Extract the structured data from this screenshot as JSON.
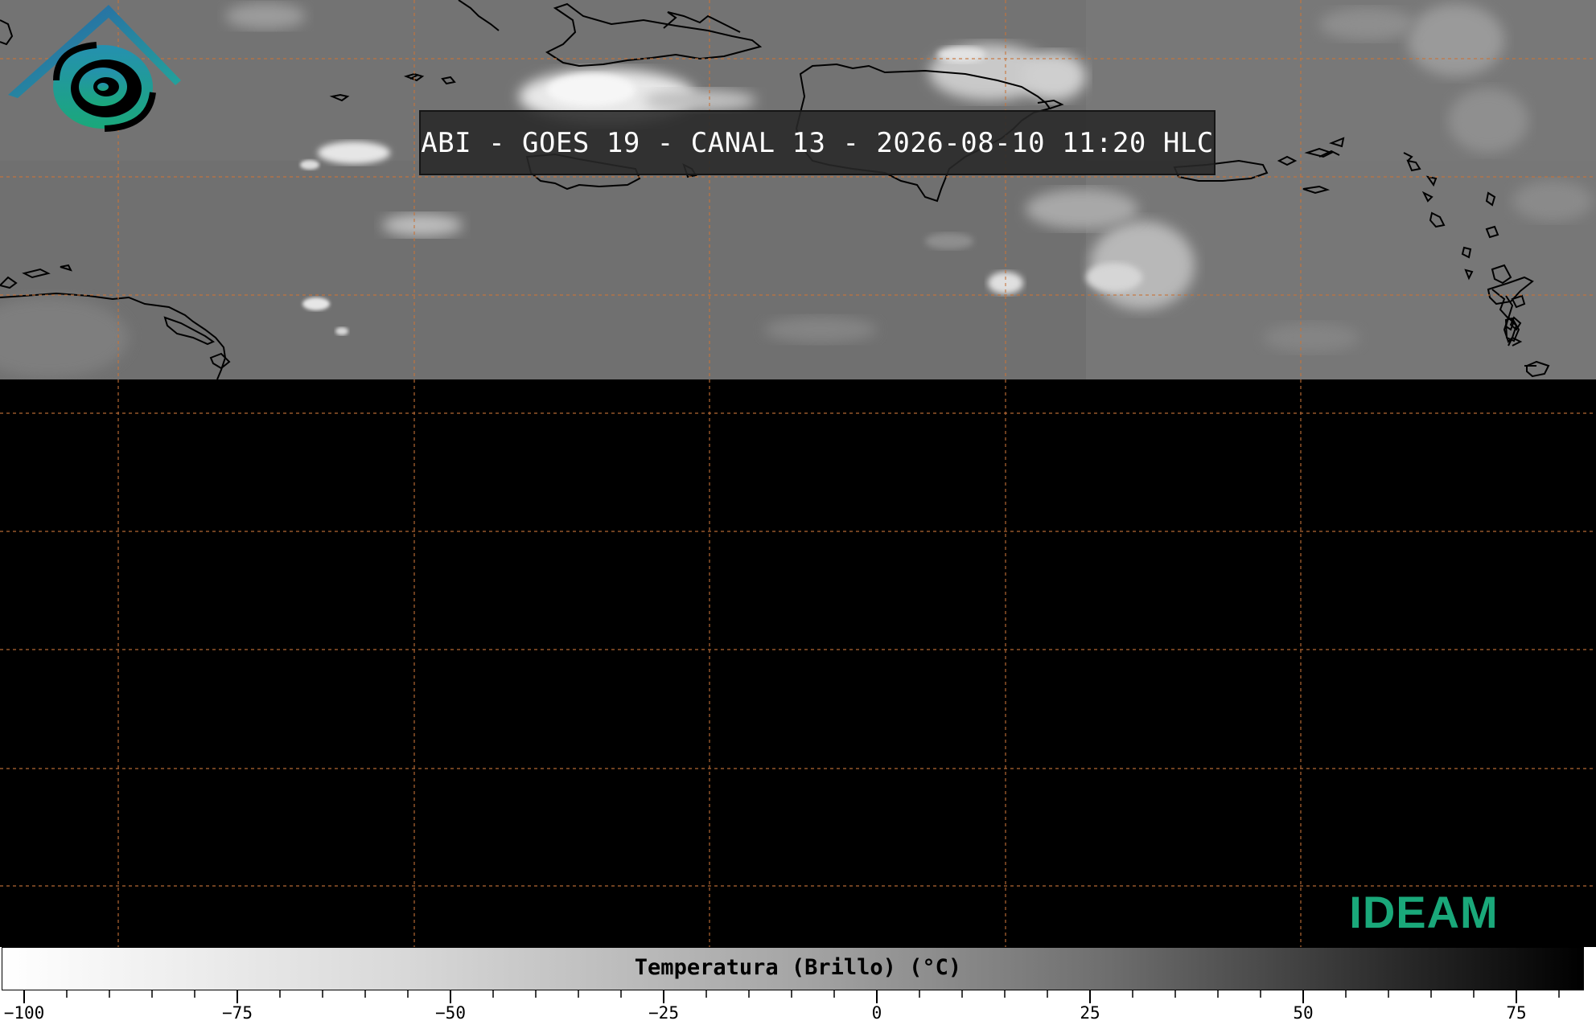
{
  "title": "ABI - GOES 19 - CANAL 13 - 2026-08-10 11:20 HLC",
  "logo": {
    "text": "IDEAM",
    "colors": {
      "roof": "#2a6fb3",
      "swirl": "#22a79a",
      "text": "#1aa87a"
    }
  },
  "colorbar": {
    "label": "Temperatura (Brillo) (°C)",
    "range": [
      -100,
      85
    ],
    "ticks": [
      "-100",
      "-75",
      "-50",
      "-25",
      "0",
      "25",
      "50",
      "75"
    ]
  },
  "map": {
    "gridline_color": "#c8743a",
    "land_outline_color": "#000000",
    "no_data_color": "#000000"
  }
}
